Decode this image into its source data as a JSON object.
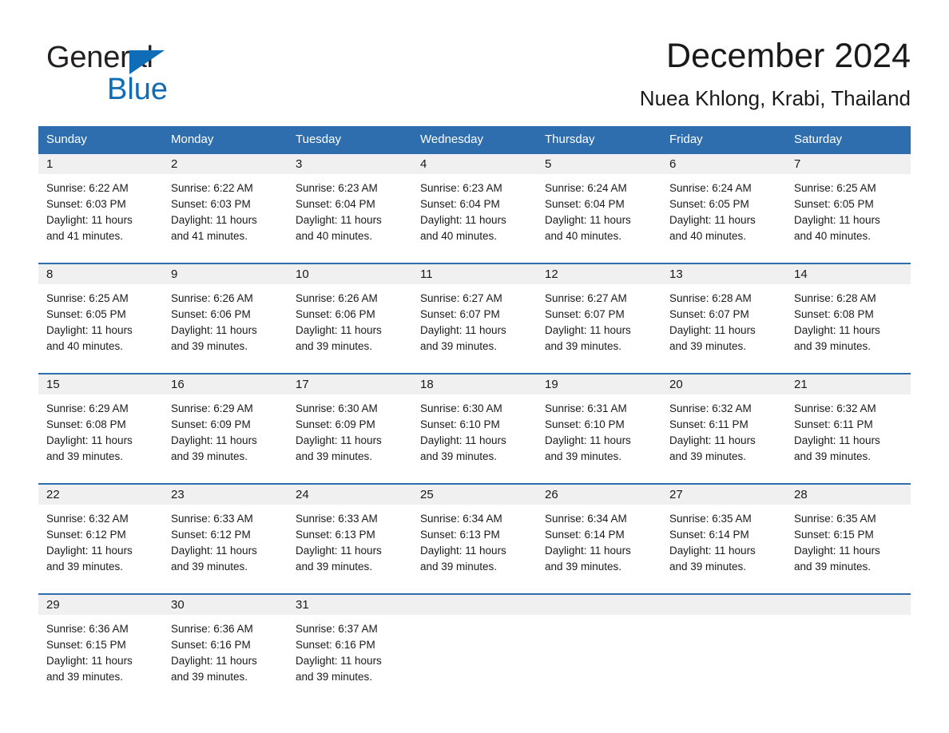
{
  "brand": {
    "name_part1": "General",
    "name_part2": "Blue",
    "triangle_icon": "triangle-logo-icon",
    "blue": "#0f6cb6"
  },
  "header": {
    "title": "December 2024",
    "location": "Nuea Khlong, Krabi, Thailand"
  },
  "colors": {
    "header_blue": "#2e6eaf",
    "daynum_band": "#f0f0f0",
    "text": "#1a1a1a"
  },
  "calendar": {
    "weekday_headers": [
      "Sunday",
      "Monday",
      "Tuesday",
      "Wednesday",
      "Thursday",
      "Friday",
      "Saturday"
    ],
    "weeks": [
      [
        {
          "day": "1",
          "sunrise": "Sunrise: 6:22 AM",
          "sunset": "Sunset: 6:03 PM",
          "daylight1": "Daylight: 11 hours",
          "daylight2": "and 41 minutes."
        },
        {
          "day": "2",
          "sunrise": "Sunrise: 6:22 AM",
          "sunset": "Sunset: 6:03 PM",
          "daylight1": "Daylight: 11 hours",
          "daylight2": "and 41 minutes."
        },
        {
          "day": "3",
          "sunrise": "Sunrise: 6:23 AM",
          "sunset": "Sunset: 6:04 PM",
          "daylight1": "Daylight: 11 hours",
          "daylight2": "and 40 minutes."
        },
        {
          "day": "4",
          "sunrise": "Sunrise: 6:23 AM",
          "sunset": "Sunset: 6:04 PM",
          "daylight1": "Daylight: 11 hours",
          "daylight2": "and 40 minutes."
        },
        {
          "day": "5",
          "sunrise": "Sunrise: 6:24 AM",
          "sunset": "Sunset: 6:04 PM",
          "daylight1": "Daylight: 11 hours",
          "daylight2": "and 40 minutes."
        },
        {
          "day": "6",
          "sunrise": "Sunrise: 6:24 AM",
          "sunset": "Sunset: 6:05 PM",
          "daylight1": "Daylight: 11 hours",
          "daylight2": "and 40 minutes."
        },
        {
          "day": "7",
          "sunrise": "Sunrise: 6:25 AM",
          "sunset": "Sunset: 6:05 PM",
          "daylight1": "Daylight: 11 hours",
          "daylight2": "and 40 minutes."
        }
      ],
      [
        {
          "day": "8",
          "sunrise": "Sunrise: 6:25 AM",
          "sunset": "Sunset: 6:05 PM",
          "daylight1": "Daylight: 11 hours",
          "daylight2": "and 40 minutes."
        },
        {
          "day": "9",
          "sunrise": "Sunrise: 6:26 AM",
          "sunset": "Sunset: 6:06 PM",
          "daylight1": "Daylight: 11 hours",
          "daylight2": "and 39 minutes."
        },
        {
          "day": "10",
          "sunrise": "Sunrise: 6:26 AM",
          "sunset": "Sunset: 6:06 PM",
          "daylight1": "Daylight: 11 hours",
          "daylight2": "and 39 minutes."
        },
        {
          "day": "11",
          "sunrise": "Sunrise: 6:27 AM",
          "sunset": "Sunset: 6:07 PM",
          "daylight1": "Daylight: 11 hours",
          "daylight2": "and 39 minutes."
        },
        {
          "day": "12",
          "sunrise": "Sunrise: 6:27 AM",
          "sunset": "Sunset: 6:07 PM",
          "daylight1": "Daylight: 11 hours",
          "daylight2": "and 39 minutes."
        },
        {
          "day": "13",
          "sunrise": "Sunrise: 6:28 AM",
          "sunset": "Sunset: 6:07 PM",
          "daylight1": "Daylight: 11 hours",
          "daylight2": "and 39 minutes."
        },
        {
          "day": "14",
          "sunrise": "Sunrise: 6:28 AM",
          "sunset": "Sunset: 6:08 PM",
          "daylight1": "Daylight: 11 hours",
          "daylight2": "and 39 minutes."
        }
      ],
      [
        {
          "day": "15",
          "sunrise": "Sunrise: 6:29 AM",
          "sunset": "Sunset: 6:08 PM",
          "daylight1": "Daylight: 11 hours",
          "daylight2": "and 39 minutes."
        },
        {
          "day": "16",
          "sunrise": "Sunrise: 6:29 AM",
          "sunset": "Sunset: 6:09 PM",
          "daylight1": "Daylight: 11 hours",
          "daylight2": "and 39 minutes."
        },
        {
          "day": "17",
          "sunrise": "Sunrise: 6:30 AM",
          "sunset": "Sunset: 6:09 PM",
          "daylight1": "Daylight: 11 hours",
          "daylight2": "and 39 minutes."
        },
        {
          "day": "18",
          "sunrise": "Sunrise: 6:30 AM",
          "sunset": "Sunset: 6:10 PM",
          "daylight1": "Daylight: 11 hours",
          "daylight2": "and 39 minutes."
        },
        {
          "day": "19",
          "sunrise": "Sunrise: 6:31 AM",
          "sunset": "Sunset: 6:10 PM",
          "daylight1": "Daylight: 11 hours",
          "daylight2": "and 39 minutes."
        },
        {
          "day": "20",
          "sunrise": "Sunrise: 6:32 AM",
          "sunset": "Sunset: 6:11 PM",
          "daylight1": "Daylight: 11 hours",
          "daylight2": "and 39 minutes."
        },
        {
          "day": "21",
          "sunrise": "Sunrise: 6:32 AM",
          "sunset": "Sunset: 6:11 PM",
          "daylight1": "Daylight: 11 hours",
          "daylight2": "and 39 minutes."
        }
      ],
      [
        {
          "day": "22",
          "sunrise": "Sunrise: 6:32 AM",
          "sunset": "Sunset: 6:12 PM",
          "daylight1": "Daylight: 11 hours",
          "daylight2": "and 39 minutes."
        },
        {
          "day": "23",
          "sunrise": "Sunrise: 6:33 AM",
          "sunset": "Sunset: 6:12 PM",
          "daylight1": "Daylight: 11 hours",
          "daylight2": "and 39 minutes."
        },
        {
          "day": "24",
          "sunrise": "Sunrise: 6:33 AM",
          "sunset": "Sunset: 6:13 PM",
          "daylight1": "Daylight: 11 hours",
          "daylight2": "and 39 minutes."
        },
        {
          "day": "25",
          "sunrise": "Sunrise: 6:34 AM",
          "sunset": "Sunset: 6:13 PM",
          "daylight1": "Daylight: 11 hours",
          "daylight2": "and 39 minutes."
        },
        {
          "day": "26",
          "sunrise": "Sunrise: 6:34 AM",
          "sunset": "Sunset: 6:14 PM",
          "daylight1": "Daylight: 11 hours",
          "daylight2": "and 39 minutes."
        },
        {
          "day": "27",
          "sunrise": "Sunrise: 6:35 AM",
          "sunset": "Sunset: 6:14 PM",
          "daylight1": "Daylight: 11 hours",
          "daylight2": "and 39 minutes."
        },
        {
          "day": "28",
          "sunrise": "Sunrise: 6:35 AM",
          "sunset": "Sunset: 6:15 PM",
          "daylight1": "Daylight: 11 hours",
          "daylight2": "and 39 minutes."
        }
      ],
      [
        {
          "day": "29",
          "sunrise": "Sunrise: 6:36 AM",
          "sunset": "Sunset: 6:15 PM",
          "daylight1": "Daylight: 11 hours",
          "daylight2": "and 39 minutes."
        },
        {
          "day": "30",
          "sunrise": "Sunrise: 6:36 AM",
          "sunset": "Sunset: 6:16 PM",
          "daylight1": "Daylight: 11 hours",
          "daylight2": "and 39 minutes."
        },
        {
          "day": "31",
          "sunrise": "Sunrise: 6:37 AM",
          "sunset": "Sunset: 6:16 PM",
          "daylight1": "Daylight: 11 hours",
          "daylight2": "and 39 minutes."
        },
        {
          "day": "",
          "sunrise": "",
          "sunset": "",
          "daylight1": "",
          "daylight2": ""
        },
        {
          "day": "",
          "sunrise": "",
          "sunset": "",
          "daylight1": "",
          "daylight2": ""
        },
        {
          "day": "",
          "sunrise": "",
          "sunset": "",
          "daylight1": "",
          "daylight2": ""
        },
        {
          "day": "",
          "sunrise": "",
          "sunset": "",
          "daylight1": "",
          "daylight2": ""
        }
      ]
    ]
  }
}
